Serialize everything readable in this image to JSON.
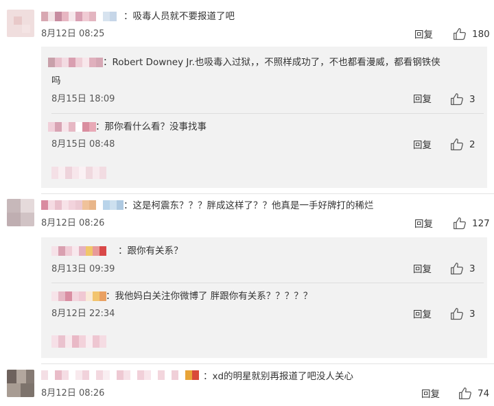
{
  "comments": [
    {
      "text": "：吸毒人员就不要报道了吧",
      "time": "8月12日 08:25",
      "reply_label": "回复",
      "likes": "180",
      "replies": [
        {
          "text_line1": "：Robert Downey Jr.也吸毒入过狱，，不照样成功了，不也都看漫威，都看钢铁侠",
          "text_line2": "吗",
          "time": "8月15日 18:09",
          "reply_label": "回复",
          "likes": "3"
        },
        {
          "text": "：那你看什么看？没事找事",
          "time": "8月15日 08:48",
          "reply_label": "回复",
          "likes": "2"
        }
      ]
    },
    {
      "text": "：这是柯震东？？？胖成这样了？？他真是一手好牌打的稀烂",
      "time": "8月12日 08:26",
      "reply_label": "回复",
      "likes": "127",
      "replies": [
        {
          "text": "：跟你有关系？",
          "time": "8月13日 09:39",
          "reply_label": "回复",
          "likes": "3"
        },
        {
          "text": "：我他妈白关注你微博了 胖跟你有关系？？？？？",
          "time": "8月12日 22:34",
          "reply_label": "回复",
          "likes": "3"
        }
      ]
    },
    {
      "text": "：xd的明星就别再报道了吧没人关心",
      "time": "8月12日 08:26",
      "reply_label": "回复",
      "likes": "74"
    }
  ],
  "icons": {
    "like": "thumbs-up-icon"
  },
  "colors": {
    "text": "#333333",
    "reply_bg": "#f2f2f2",
    "icon": "#555555"
  }
}
